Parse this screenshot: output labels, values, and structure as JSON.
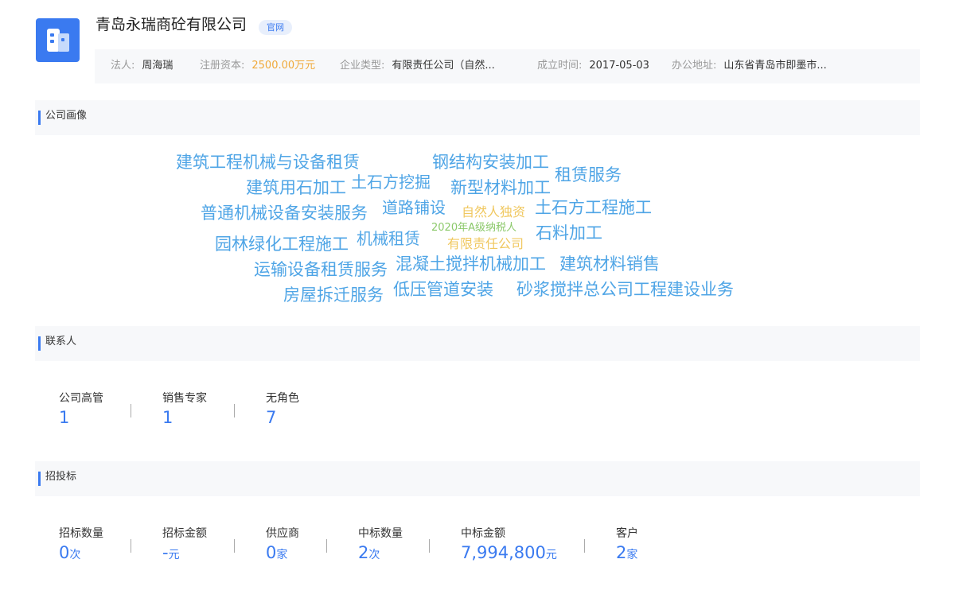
{
  "company": {
    "name": "青岛永瑞商砼有限公司",
    "site_badge": "官网"
  },
  "info": {
    "legal_rep_label": "法人:",
    "legal_rep": "周海瑞",
    "capital_label": "注册资本:",
    "capital": "2500.00万元",
    "type_label": "企业类型:",
    "type": "有限责任公司（自然...",
    "founded_label": "成立时间:",
    "founded": "2017-05-03",
    "address_label": "办公地址:",
    "address": "山东省青岛市即墨市..."
  },
  "sections": {
    "portrait": "公司画像",
    "contacts": "联系人",
    "bidding": "招投标"
  },
  "colors": {
    "accent": "#3a7af0",
    "cloud_blue": "#4fa5e6",
    "cloud_orange": "#f0c860",
    "cloud_green": "#8cc96b"
  },
  "word_cloud": [
    "建筑工程机械与设备租赁",
    "钢结构安装加工",
    "租赁服务",
    "建筑用石加工",
    "土石方挖掘",
    "新型材料加工",
    "普通机械设备安装服务",
    "道路铺设",
    "自然人独资",
    "土石方工程施工",
    "2020年A级纳税人",
    "园林绿化工程施工",
    "机械租赁",
    "有限责任公司",
    "石料加工",
    "运输设备租赁服务",
    "混凝土搅拌机械加工",
    "建筑材料销售",
    "房屋拆迁服务",
    "低压管道安装",
    "砂浆搅拌总公司工程建设业务"
  ],
  "contacts": [
    {
      "label": "公司高管",
      "value": "1"
    },
    {
      "label": "销售专家",
      "value": "1"
    },
    {
      "label": "无角色",
      "value": "7"
    }
  ],
  "bidding": [
    {
      "label": "招标数量",
      "value": "0",
      "unit": "次"
    },
    {
      "label": "招标金额",
      "value": "-",
      "unit": "元"
    },
    {
      "label": "供应商",
      "value": "0",
      "unit": "家"
    },
    {
      "label": "中标数量",
      "value": "2",
      "unit": "次"
    },
    {
      "label": "中标金额",
      "value": "7,994,800",
      "unit": "元"
    },
    {
      "label": "客户",
      "value": "2",
      "unit": "家"
    }
  ]
}
